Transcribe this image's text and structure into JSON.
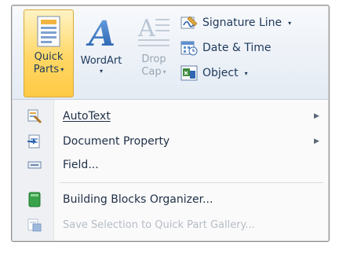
{
  "ribbon": {
    "quick_parts": {
      "line1": "Quick",
      "line2": "Parts",
      "caret": "▾",
      "icon": "quick-parts-icon"
    },
    "wordart": {
      "label": "WordArt",
      "caret": "▾",
      "icon": "wordart-icon"
    },
    "drop_cap": {
      "line1": "Drop",
      "line2": "Cap",
      "caret": "▾",
      "icon": "drop-cap-icon"
    },
    "small_buttons": [
      {
        "label": "Signature Line",
        "caret": "▾",
        "icon": "signature-line-icon"
      },
      {
        "label": "Date & Time",
        "caret": "",
        "icon": "date-time-icon"
      },
      {
        "label": "Object",
        "caret": "▾",
        "icon": "object-icon"
      }
    ]
  },
  "menu": {
    "items": [
      {
        "label": "AutoText",
        "icon": "autotext-icon",
        "has_submenu": true,
        "submenu_glyph": "▶"
      },
      {
        "label": "Document Property",
        "icon": "document-property-icon",
        "has_submenu": true,
        "submenu_glyph": "▶"
      },
      {
        "label": "Field...",
        "icon": "field-icon",
        "has_submenu": false
      },
      {
        "label": "Building Blocks Organizer...",
        "icon": "building-blocks-icon",
        "has_submenu": false
      },
      {
        "label": "Save Selection to Quick Part Gallery...",
        "icon": "save-selection-icon",
        "has_submenu": false,
        "disabled": true
      }
    ]
  },
  "colors": {
    "highlight": "#ffd766",
    "text": "#1e395b",
    "disabled_text": "#b6bcc5"
  }
}
